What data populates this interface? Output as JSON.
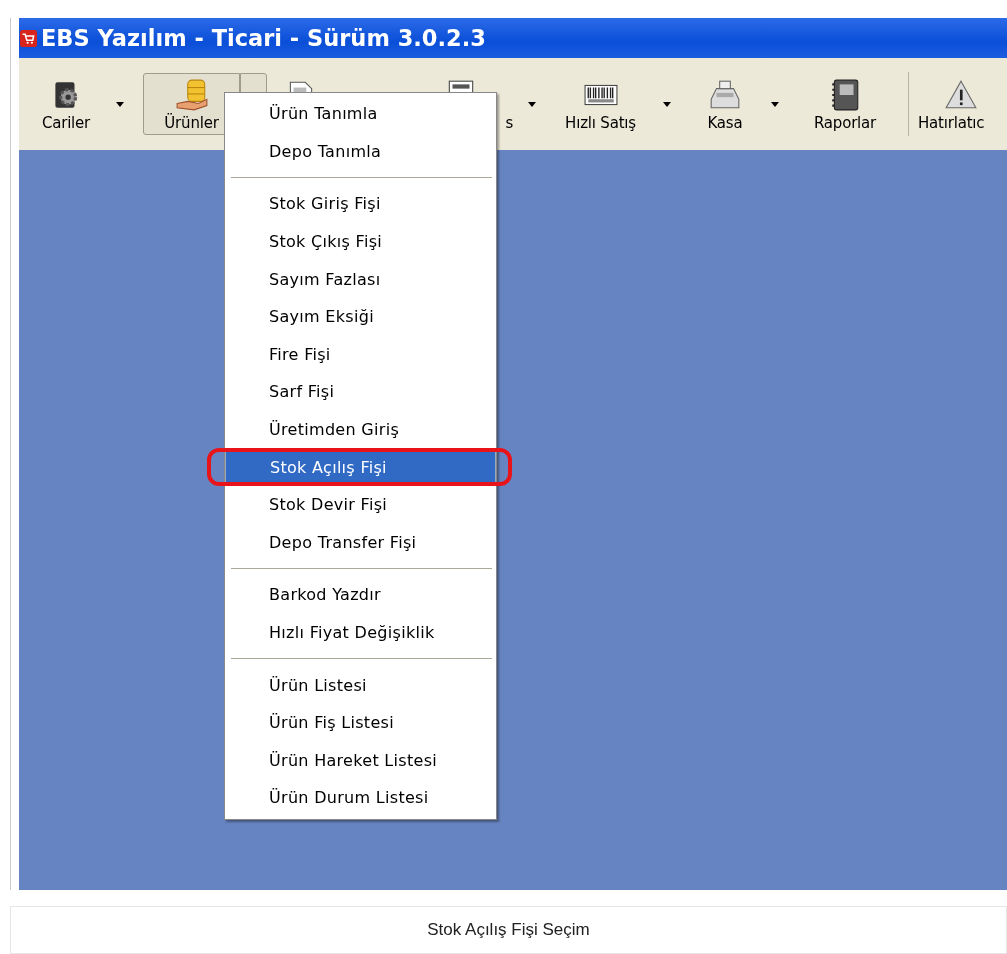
{
  "window": {
    "title": "EBS Yazılım - Ticari - Sürüm 3.0.2.3"
  },
  "toolbar": {
    "groups": [
      [
        {
          "label": "Cariler",
          "dropdown": true,
          "pressed": false
        },
        {
          "label": "Ürünler",
          "dropdown": true,
          "pressed": true
        },
        {
          "dropdown": false,
          "pressed": false
        },
        {
          "label": "s",
          "dropdown": true,
          "pressed": false
        },
        {
          "label": "Hızlı Satış",
          "dropdown": true,
          "pressed": false
        },
        {
          "label": "Kasa",
          "dropdown": true,
          "pressed": false
        },
        {
          "label": "Raporlar",
          "dropdown": false,
          "pressed": false
        }
      ],
      [
        {
          "label": "Hatırlatıc",
          "dropdown": false,
          "pressed": false
        }
      ]
    ]
  },
  "menu": {
    "groups": [
      [
        {
          "label": "Ürün Tanımla",
          "selected": false
        },
        {
          "label": "Depo Tanımla",
          "selected": false
        }
      ],
      [
        {
          "label": "Stok Giriş Fişi",
          "selected": false
        },
        {
          "label": "Stok Çıkış Fişi",
          "selected": false
        },
        {
          "label": "Sayım Fazlası",
          "selected": false
        },
        {
          "label": "Sayım Eksiği",
          "selected": false
        },
        {
          "label": "Fire Fişi",
          "selected": false
        },
        {
          "label": "Sarf Fişi",
          "selected": false
        },
        {
          "label": "Üretimden Giriş",
          "selected": false
        },
        {
          "label": "Stok Açılış Fişi",
          "selected": true
        },
        {
          "label": "Stok Devir Fişi",
          "selected": false
        },
        {
          "label": "Depo Transfer Fişi",
          "selected": false
        }
      ],
      [
        {
          "label": "Barkod Yazdır",
          "selected": false
        },
        {
          "label": "Hızlı Fiyat Değişiklik",
          "selected": false
        }
      ],
      [
        {
          "label": "Ürün Listesi",
          "selected": false
        },
        {
          "label": "Ürün Fiş Listesi",
          "selected": false
        },
        {
          "label": "Ürün Hareket Listesi",
          "selected": false
        },
        {
          "label": "Ürün Durum Listesi",
          "selected": false
        }
      ]
    ]
  },
  "caption": "Stok Açılış Fişi Seçim"
}
